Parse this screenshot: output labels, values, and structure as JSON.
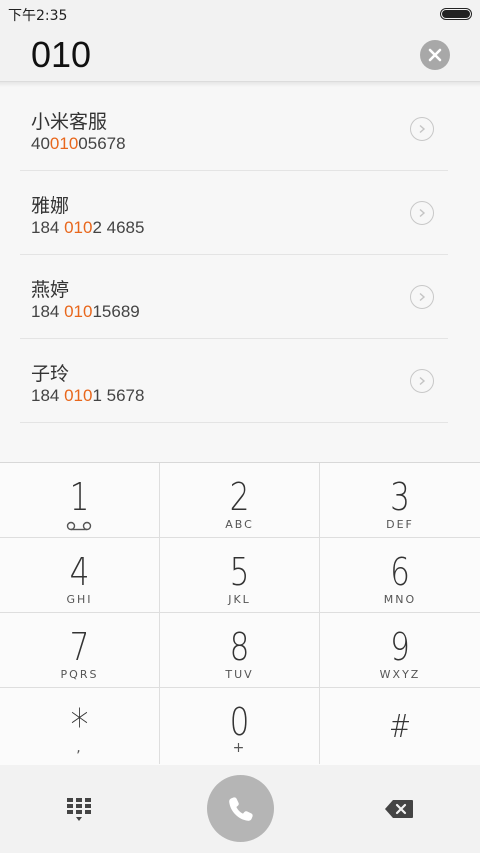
{
  "status_bar": {
    "time": "下午2:35",
    "battery_icon": "battery-full-icon"
  },
  "dial_input": {
    "value": "010",
    "clear_icon": "clear-circle-icon"
  },
  "contacts": [
    {
      "name": "小米客服",
      "number_pre": "40",
      "number_match": "010",
      "number_post": "05678"
    },
    {
      "name": "雅娜",
      "number_pre": "184 ",
      "number_match": "010",
      "number_post": "2 4685"
    },
    {
      "name": "燕婷",
      "number_pre": "184 ",
      "number_match": "010",
      "number_post": "15689"
    },
    {
      "name": "子玲",
      "number_pre": "184 ",
      "number_match": "010",
      "number_post": "1 5678"
    }
  ],
  "keypad": {
    "keys": [
      {
        "digit": "1",
        "letters": ""
      },
      {
        "digit": "2",
        "letters": "ABC"
      },
      {
        "digit": "3",
        "letters": "DEF"
      },
      {
        "digit": "4",
        "letters": "GHI"
      },
      {
        "digit": "5",
        "letters": "JKL"
      },
      {
        "digit": "6",
        "letters": "MNO"
      },
      {
        "digit": "7",
        "letters": "PQRS"
      },
      {
        "digit": "8",
        "letters": "TUV"
      },
      {
        "digit": "9",
        "letters": "WXYZ"
      },
      {
        "digit": "*",
        "letters": ","
      },
      {
        "digit": "0",
        "letters": "+"
      },
      {
        "digit": "#",
        "letters": ""
      }
    ]
  },
  "actions": {
    "dialpad_icon": "dialpad-icon",
    "call_icon": "phone-icon",
    "backspace_icon": "backspace-icon"
  },
  "colors": {
    "match_highlight": "#e8671c",
    "call_button": "#b5b5b5"
  }
}
